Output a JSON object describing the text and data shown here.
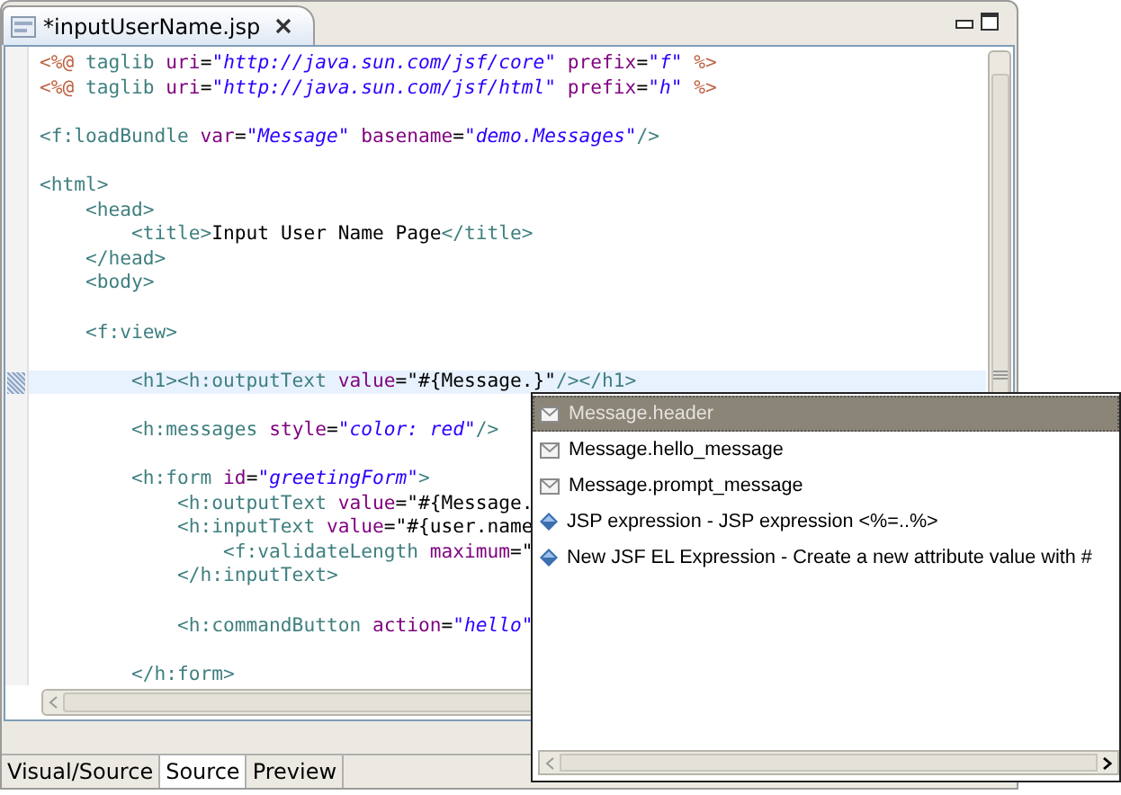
{
  "editor_tab": {
    "title": "*inputUserName.jsp"
  },
  "code_lines": [
    {
      "current": false,
      "tokens": [
        {
          "kind": "jsp",
          "text": "<%@ "
        },
        {
          "kind": "tag",
          "text": "taglib "
        },
        {
          "kind": "attr",
          "text": "uri"
        },
        {
          "kind": "plain",
          "text": "="
        },
        {
          "kind": "str",
          "text": "\"http://java.sun.com/jsf/core\" "
        },
        {
          "kind": "attr",
          "text": "prefix"
        },
        {
          "kind": "plain",
          "text": "="
        },
        {
          "kind": "str",
          "text": "\"f\" "
        },
        {
          "kind": "jsp",
          "text": "%>"
        }
      ]
    },
    {
      "current": false,
      "tokens": [
        {
          "kind": "jsp",
          "text": "<%@ "
        },
        {
          "kind": "tag",
          "text": "taglib "
        },
        {
          "kind": "attr",
          "text": "uri"
        },
        {
          "kind": "plain",
          "text": "="
        },
        {
          "kind": "str",
          "text": "\"http://java.sun.com/jsf/html\" "
        },
        {
          "kind": "attr",
          "text": "prefix"
        },
        {
          "kind": "plain",
          "text": "="
        },
        {
          "kind": "str",
          "text": "\"h\" "
        },
        {
          "kind": "jsp",
          "text": "%>"
        }
      ]
    },
    {
      "current": false
    },
    {
      "current": false,
      "tokens": [
        {
          "kind": "tag",
          "text": "<f:loadBundle "
        },
        {
          "kind": "attr",
          "text": "var"
        },
        {
          "kind": "plain",
          "text": "="
        },
        {
          "kind": "str",
          "text": "\"Message\" "
        },
        {
          "kind": "attr",
          "text": "basename"
        },
        {
          "kind": "plain",
          "text": "="
        },
        {
          "kind": "str",
          "text": "\"demo.Messages\""
        },
        {
          "kind": "tag",
          "text": "/>"
        }
      ]
    },
    {
      "current": false
    },
    {
      "current": false,
      "tokens": [
        {
          "kind": "tag",
          "text": "<html>"
        }
      ],
      "children": [
        {
          "current": false,
          "tokens": [
            {
              "kind": "tag",
              "text": "<head>"
            }
          ],
          "children": [
            {
              "current": false,
              "tokens": [
                {
                  "kind": "tag",
                  "text": "<title>"
                },
                {
                  "kind": "plain",
                  "text": "Input User Name Page"
                },
                {
                  "kind": "tag",
                  "text": "</title>"
                }
              ]
            }
          ]
        },
        {
          "current": false,
          "tokens": [
            {
              "kind": "tag",
              "text": "</head>"
            }
          ]
        },
        {
          "current": false,
          "tokens": [
            {
              "kind": "tag",
              "text": "<body>"
            }
          ]
        },
        {
          "current": false
        },
        {
          "current": false,
          "tokens": [
            {
              "kind": "tag",
              "text": "<f:view>"
            }
          ],
          "children": [
            {
              "current": false
            },
            {
              "current": true,
              "tokens": [
                {
                  "kind": "tag",
                  "text": "<h1><h:outputText "
                },
                {
                  "kind": "attr",
                  "text": "value"
                },
                {
                  "kind": "plain",
                  "text": "=\"#{Message.}\""
                },
                {
                  "kind": "tag",
                  "text": "/></h1>"
                }
              ]
            },
            {
              "current": false
            },
            {
              "current": false,
              "tokens": [
                {
                  "kind": "tag",
                  "text": "<h:messages "
                },
                {
                  "kind": "attr",
                  "text": "style"
                },
                {
                  "kind": "plain",
                  "text": "="
                },
                {
                  "kind": "str",
                  "text": "\"color: red\""
                },
                {
                  "kind": "tag",
                  "text": "/>"
                }
              ]
            },
            {
              "current": false
            },
            {
              "current": false,
              "tokens": [
                {
                  "kind": "tag",
                  "text": "<h:form "
                },
                {
                  "kind": "attr",
                  "text": "id"
                },
                {
                  "kind": "plain",
                  "text": "="
                },
                {
                  "kind": "str",
                  "text": "\"greetingForm\""
                },
                {
                  "kind": "tag",
                  "text": ">"
                }
              ],
              "children": [
                {
                  "current": false,
                  "tokens": [
                    {
                      "kind": "tag",
                      "text": "<h:outputText "
                    },
                    {
                      "kind": "attr",
                      "text": "value"
                    },
                    {
                      "kind": "plain",
                      "text": "=\"#{Message."
                    }
                  ]
                },
                {
                  "current": false,
                  "tokens": [
                    {
                      "kind": "tag",
                      "text": "<h:inputText "
                    },
                    {
                      "kind": "attr",
                      "text": "value"
                    },
                    {
                      "kind": "plain",
                      "text": "=\"#{user.name"
                    }
                  ],
                  "children": [
                    {
                      "current": false,
                      "tokens": [
                        {
                          "kind": "tag",
                          "text": "<f:validateLength "
                        },
                        {
                          "kind": "attr",
                          "text": "maximum"
                        },
                        {
                          "kind": "plain",
                          "text": "=\""
                        }
                      ]
                    }
                  ]
                },
                {
                  "current": false,
                  "tokens": [
                    {
                      "kind": "tag",
                      "text": "</h:inputText>"
                    }
                  ]
                },
                {
                  "current": false
                },
                {
                  "current": false,
                  "tokens": [
                    {
                      "kind": "tag",
                      "text": "<h:commandButton "
                    },
                    {
                      "kind": "attr",
                      "text": "action"
                    },
                    {
                      "kind": "plain",
                      "text": "="
                    },
                    {
                      "kind": "str",
                      "text": "\"hello\""
                    }
                  ]
                },
                {
                  "current": false
                }
              ]
            },
            {
              "current": false,
              "tokens": [
                {
                  "kind": "tag",
                  "text": "</h:form>"
                }
              ]
            }
          ]
        }
      ]
    }
  ],
  "bottom_tabs": [
    {
      "label": "Visual/Source",
      "selected": false
    },
    {
      "label": "Source",
      "selected": true
    },
    {
      "label": "Preview",
      "selected": false
    }
  ],
  "completion_popup": {
    "items": [
      {
        "kind": "property",
        "label": "Message.header",
        "selected": true
      },
      {
        "kind": "property",
        "label": "Message.hello_message",
        "selected": false
      },
      {
        "kind": "property",
        "label": "Message.prompt_message",
        "selected": false
      },
      {
        "kind": "template",
        "label": "JSP expression - JSP expression <%=..%>",
        "selected": false
      },
      {
        "kind": "template",
        "label": "New JSF EL Expression - Create a new attribute value with #",
        "selected": false
      }
    ]
  }
}
